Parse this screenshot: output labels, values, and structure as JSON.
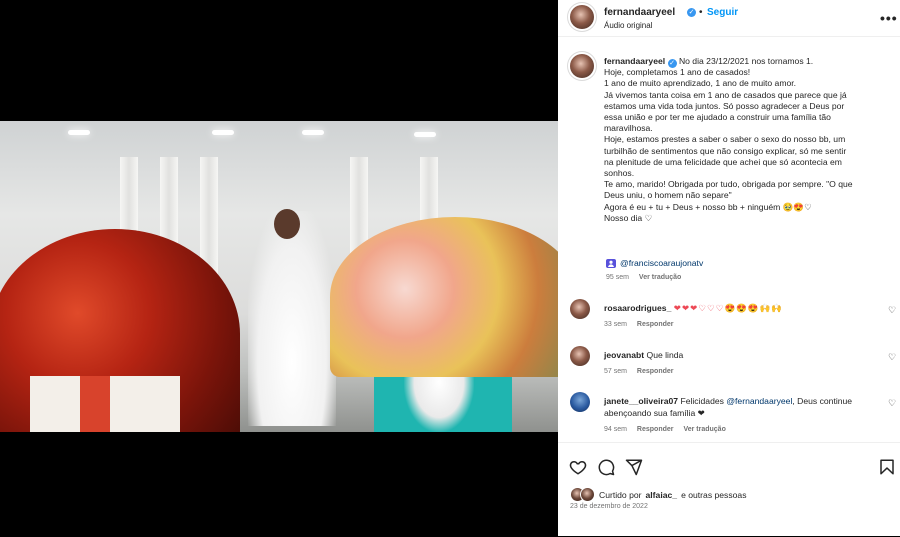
{
  "post": {
    "username": "fernandaaryeel",
    "follow_label": "Seguir",
    "audio": "Áudio original",
    "more": "•••",
    "caption_lines": [
      "No dia 23/12/2021 nos tornamos 1.",
      "Hoje, completamos 1 ano de casados!",
      "1 ano de muito aprendizado, 1 ano de muito amor.",
      "Já vivemos tanta coisa em 1 ano de casados que parece que já estamos uma vida toda juntos. Só posso agradecer a Deus por essa união e por ter me ajudado a construir uma família tão maravilhosa.",
      "Hoje, estamos prestes a saber o saber o sexo do nosso bb, um turbilhão de sentimentos que não consigo explicar, só me sentir na plenitude de uma felicidade que achei que só acontecia em sonhos.",
      "Te amo, marido! Obrigada por tudo, obrigada por sempre. \"O que Deus uniu, o homem não separe\"",
      "Agora é eu + tu + Deus + nosso bb + ninguém 🥹😍♡",
      "Nosso dia ♡"
    ],
    "tagged_user": "@franciscoaraujonatv",
    "caption_time": "95 sem",
    "see_translation": "Ver tradução",
    "liked_by_prefix": "Curtido por",
    "liked_by_user": "alfaiac_",
    "liked_by_suffix": "e outras pessoas",
    "date": "23 de dezembro de 2022"
  },
  "comments": [
    {
      "username": "rosaarodrigues_",
      "text": "❤❤❤♡♡♡😍😍😍🙌🙌",
      "time": "33 sem",
      "reply": "Responder"
    },
    {
      "username": "jeovanabt",
      "text": "Que linda",
      "time": "57 sem",
      "reply": "Responder"
    },
    {
      "username": "janete__oliveira07",
      "text_prefix": "Felicidades",
      "mention": "@fernandaaryeel",
      "text_suffix": ", Deus continue abençoando sua família ❤",
      "time": "94 sem",
      "reply": "Responder",
      "translate": "Ver tradução"
    }
  ],
  "icons": [
    "verified-icon",
    "more-icon",
    "like-icon",
    "comment-icon",
    "share-icon",
    "save-icon",
    "mute-icon",
    "person-tag-icon"
  ],
  "colors": {
    "link": "#0095f6",
    "mention": "#00376b",
    "heart": "#ed4956",
    "verified": "#3897f0",
    "secondary": "#737373"
  }
}
